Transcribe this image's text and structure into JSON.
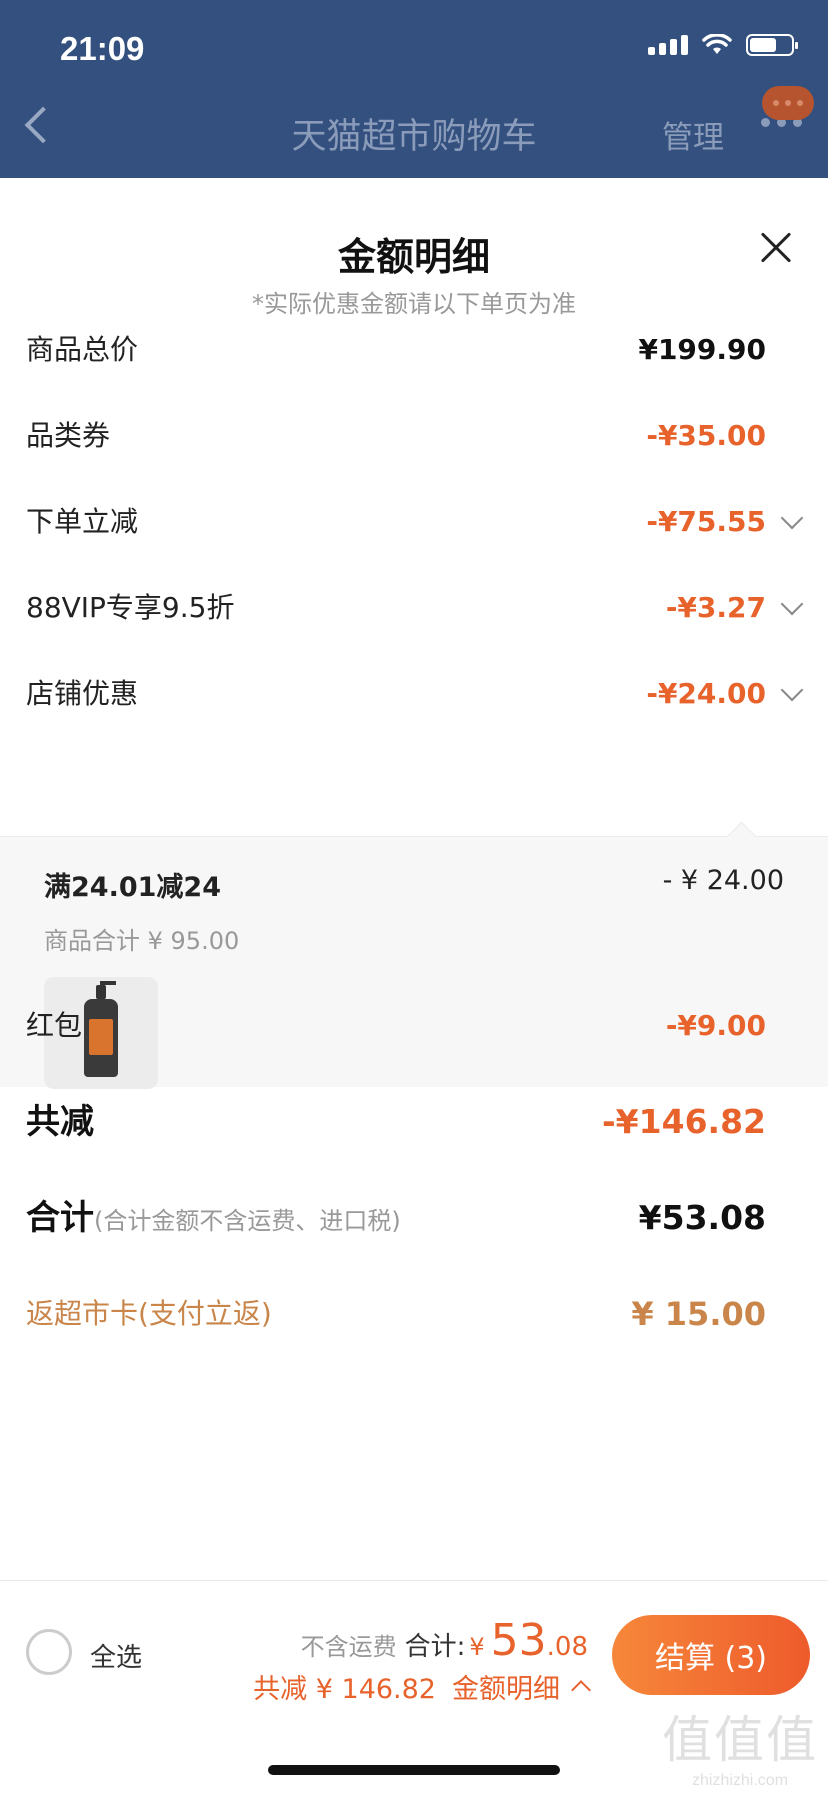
{
  "status_bar": {
    "time": "21:09"
  },
  "nav": {
    "title": "天猫超市购物车",
    "manage": "管理"
  },
  "sheet": {
    "title": "金额明细",
    "subtitle": "*实际优惠金额请以下单页为准",
    "rows": {
      "total_price": {
        "label": "商品总价",
        "value": "¥199.90"
      },
      "category_coupon": {
        "label": "品类券",
        "value": "-¥35.00"
      },
      "order_discount": {
        "label": "下单立减",
        "value": "-¥75.55"
      },
      "vip_discount": {
        "label": "88VIP专享9.5折",
        "value": "-¥3.27"
      },
      "store_discount": {
        "label": "店铺优惠",
        "value": "-¥24.00"
      },
      "red_packet": {
        "label": "红包",
        "value": "-¥9.00"
      },
      "total_saved": {
        "label": "共减",
        "value": "-¥146.82"
      },
      "sum": {
        "label": "合计",
        "note": "(合计金额不含运费、进口税)",
        "value": "¥53.08"
      },
      "rebate": {
        "label": "返超市卡(支付立返)",
        "value": "¥ 15.00"
      }
    },
    "store_detail": {
      "title": "满24.01减24",
      "amount": "- ¥ 24.00",
      "subtotal": "商品合计 ¥ 95.00"
    }
  },
  "bottom_bar": {
    "select_all": "全选",
    "no_shipping": "不含运费",
    "total_label": "合计:",
    "currency": "¥",
    "total_int": "53",
    "total_dec": ".08",
    "saved": "共减 ¥ 146.82",
    "detail_link": "金额明细",
    "checkout": "结算 (3)"
  },
  "watermark": {
    "line1": "值值值",
    "line2": "zhizhizhi.com"
  },
  "colors": {
    "header": "#34507f",
    "accent": "#e8622c",
    "rebate": "#c9854a"
  }
}
